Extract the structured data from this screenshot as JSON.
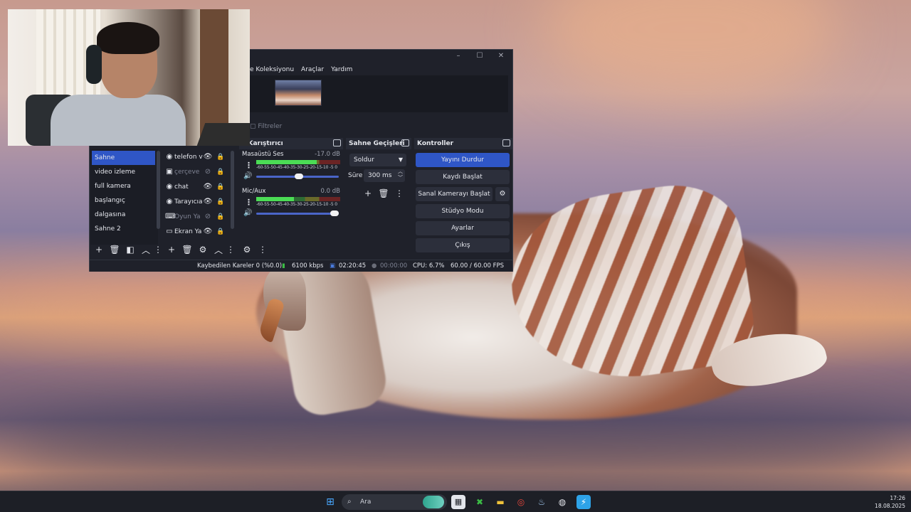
{
  "colors": {
    "accent": "#2f56c6",
    "panel": "#1f212a",
    "taskbar": "#1d1f26"
  },
  "obs": {
    "menu": [
      "e Koleksiyonu",
      "Araçlar",
      "Yardım"
    ],
    "filters_label": "Filtreler",
    "scenes": [
      "Sahne",
      "video izleme",
      "full kamera",
      "başlangıç",
      "dalgasına",
      "Sahne 2"
    ],
    "sources": [
      {
        "name": "telefon v",
        "icon": "globe-icon",
        "visible": true,
        "dim": false
      },
      {
        "name": "çerçeve",
        "icon": "image-icon",
        "visible": false,
        "dim": true
      },
      {
        "name": "chat",
        "icon": "globe-icon",
        "visible": true,
        "dim": false
      },
      {
        "name": "Tarayıcıa",
        "icon": "globe-icon",
        "visible": true,
        "dim": false
      },
      {
        "name": "Oyun Ya",
        "icon": "gamepad-icon",
        "visible": false,
        "dim": true
      },
      {
        "name": "Ekran Ya",
        "icon": "monitor-icon",
        "visible": true,
        "dim": false
      }
    ],
    "mixer": {
      "title": "s Karıştırıcı",
      "ticks": "-60-55-50-45-40-35-30-25-20-15-10 -5  0",
      "tracks": [
        {
          "name": "Masaüstü Ses",
          "db": "-17.0 dB",
          "level": 0.72
        },
        {
          "name": "Mic/Aux",
          "db": "0.0 dB",
          "level": 0.45
        }
      ]
    },
    "transitions": {
      "title": "Sahne Geçişleri",
      "selected": "Soldur",
      "duration_label": "Süre",
      "duration_value": "300 ms"
    },
    "controls": {
      "title": "Kontroller",
      "stop_stream": "Yayını Durdur",
      "start_recording": "Kaydı Başlat",
      "virtual_camera": "Sanal Kamerayı Başlat",
      "studio_mode": "Stüdyo Modu",
      "settings": "Ayarlar",
      "exit": "Çıkış"
    },
    "status": {
      "dropped": "Kaybedilen Kareler 0 (%0.0)",
      "bitrate": "6100 kbps",
      "stream_time": "02:20:45",
      "rec_time": "00:00:00",
      "cpu": "CPU: 6.7%",
      "fps": "60.00 / 60.00 FPS"
    }
  },
  "taskbar": {
    "search_placeholder": "Ara",
    "time": "17:26",
    "date": "18.08.2025"
  }
}
